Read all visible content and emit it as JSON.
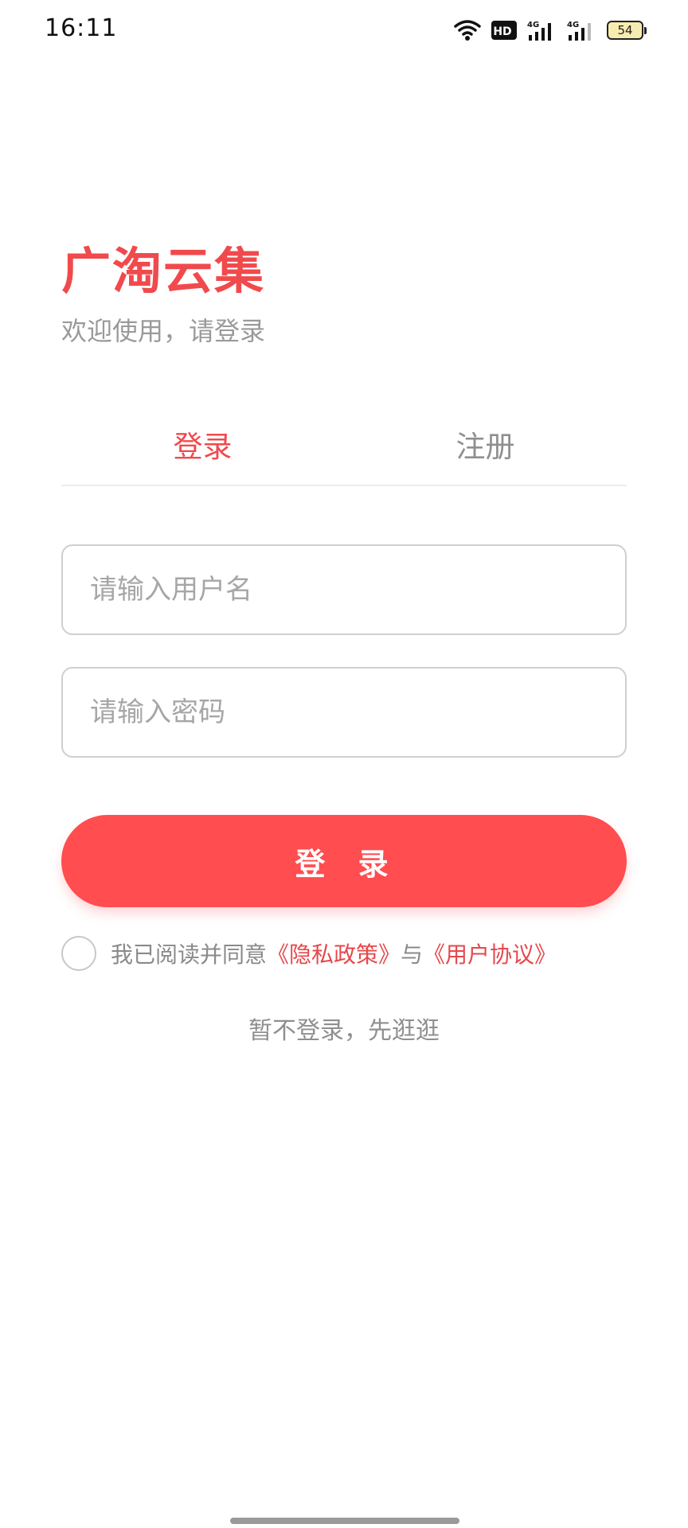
{
  "status_bar": {
    "time": "16:11",
    "battery_level": "54",
    "network_label": "4G",
    "hd_label": "HD"
  },
  "brand": {
    "title": "广淘云集",
    "subtitle": "欢迎使用，请登录",
    "color": "#f04a4d"
  },
  "tabs": [
    {
      "label": "登录",
      "active": true
    },
    {
      "label": "注册",
      "active": false
    }
  ],
  "form": {
    "username_placeholder": "请输入用户名",
    "username_value": "",
    "password_placeholder": "请输入密码",
    "password_value": "",
    "login_button_label": "登 录",
    "button_color": "#ff4d50"
  },
  "agreement": {
    "checked": false,
    "prefix": "我已阅读并同意",
    "privacy_link": "《隐私政策》",
    "connector": "与",
    "user_agreement_link": "《用户协议》",
    "link_color": "#e5484c"
  },
  "browse_label": "暂不登录，先逛逛"
}
